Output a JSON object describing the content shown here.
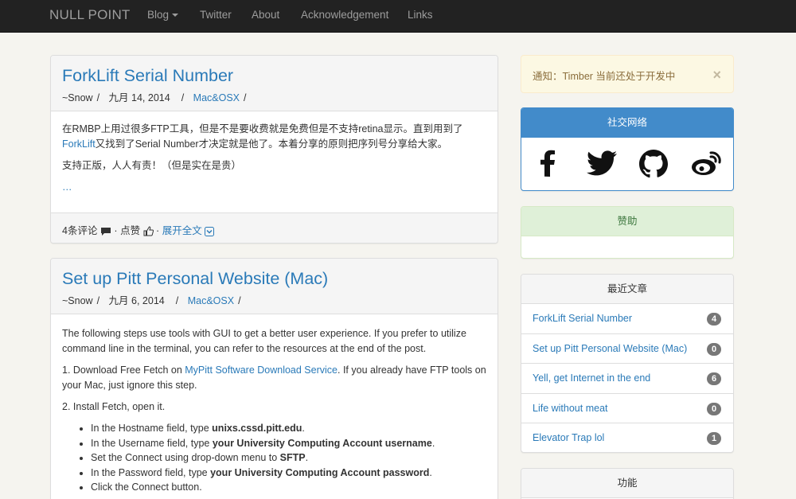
{
  "navbar": {
    "brand": "NULL POINT",
    "items": [
      {
        "label": "Blog",
        "has_caret": true
      },
      {
        "label": "Twitter"
      },
      {
        "label": "About"
      },
      {
        "label": "Acknowledgement"
      },
      {
        "label": "Links"
      }
    ]
  },
  "posts": [
    {
      "title": "ForkLift Serial Number",
      "author": "~Snow",
      "date": "九月 14, 2014",
      "category": "Mac&OSX",
      "para1_a": "在RMBP上用过很多FTP工具，但是不是要收费就是免费但是不支持retina显示。直到用到了",
      "para1_link": "ForkLift",
      "para1_b": "又找到了Serial Number才决定就是他了。本着分享的原则把序列号分享给大家。",
      "para2": "支持正版，人人有责！（但是实在是贵）",
      "more": "…",
      "comments": "4条评论",
      "likes": "点赞",
      "expand": "展开全文"
    },
    {
      "title": "Set up Pitt Personal Website (Mac)",
      "author": "~Snow",
      "date": "九月 6, 2014",
      "category": "Mac&OSX",
      "para1": "The following steps use tools with GUI to get a better user experience. If you prefer to utilize command line in the terminal, you can refer to the resources at the end of the post.",
      "step1_a": "1. Download Free Fetch on ",
      "step1_link": "MyPitt Software Download Service",
      "step1_b": ". If you already have FTP tools on your Mac, just ignore this step.",
      "step2": "2. Install Fetch, open it.",
      "bullets": [
        {
          "pre": "In the Hostname field, type ",
          "bold": "unixs.cssd.pitt.edu",
          "post": "."
        },
        {
          "pre": "In the Username field, type ",
          "bold": "your University Computing Account username",
          "post": "."
        },
        {
          "pre": "Set the Connect using drop-down menu to ",
          "bold": "SFTP",
          "post": "."
        },
        {
          "pre": "In the Password field, type ",
          "bold": "your University Computing Account password",
          "post": "."
        },
        {
          "pre": "Click the Connect button.",
          "bold": "",
          "post": ""
        }
      ]
    }
  ],
  "sidebar": {
    "notice": "通知：Timber 当前还处于开发中",
    "notice_close": "×",
    "social_title": "社交网络",
    "social_icons": [
      "facebook-icon",
      "twitter-icon",
      "github-icon",
      "weibo-icon"
    ],
    "sponsor_title": "赞助",
    "recent_title": "最近文章",
    "recent": [
      {
        "title": "ForkLift Serial Number",
        "count": "4"
      },
      {
        "title": "Set up Pitt Personal Website (Mac)",
        "count": "0"
      },
      {
        "title": "Yell, get Internet in the end",
        "count": "6"
      },
      {
        "title": "Life without meat",
        "count": "0"
      },
      {
        "title": "Elevator Trap lol",
        "count": "1"
      }
    ],
    "functions_title": "功能"
  },
  "colors": {
    "navbar_bg": "#222222",
    "link": "#2a7ab8",
    "social_head": "#428bca",
    "sponsor_head": "#dff0d8",
    "alert_bg": "#fcf8e3",
    "badge": "#777777"
  }
}
